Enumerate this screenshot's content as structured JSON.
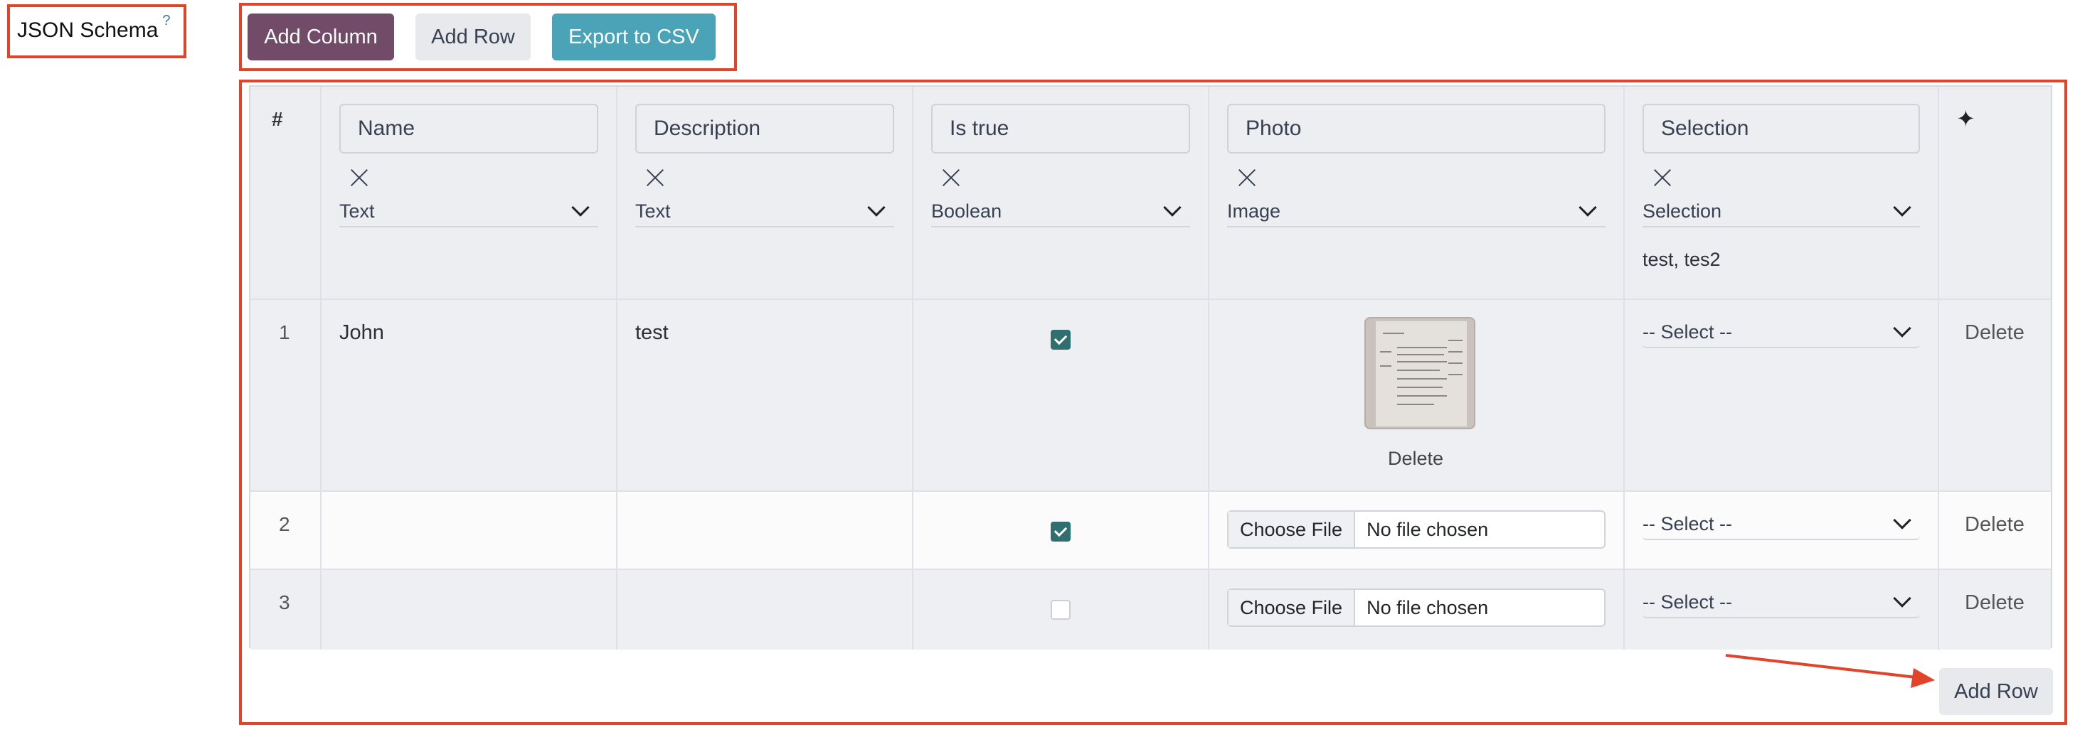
{
  "schema_label": {
    "text": "JSON Schema",
    "help": "?"
  },
  "toolbar": {
    "add_column": "Add Column",
    "add_row": "Add Row",
    "export_csv": "Export to CSV"
  },
  "table": {
    "index_header": "#",
    "actions_header_icon": "sparkle-icon",
    "columns": [
      {
        "name": "Name",
        "type": "Text"
      },
      {
        "name": "Description",
        "type": "Text"
      },
      {
        "name": "Is true",
        "type": "Boolean"
      },
      {
        "name": "Photo",
        "type": "Image"
      },
      {
        "name": "Selection",
        "type": "Selection",
        "options": "test, tes2"
      }
    ],
    "rows": [
      {
        "index": "1",
        "name": "John",
        "description": "test",
        "is_true": true,
        "photo": {
          "has_image": true,
          "delete_label": "Delete"
        },
        "selection": "-- Select --",
        "delete_label": "Delete"
      },
      {
        "index": "2",
        "name": "",
        "description": "",
        "is_true": true,
        "photo": {
          "has_image": false,
          "choose_label": "Choose File",
          "status": "No file chosen"
        },
        "selection": "-- Select --",
        "delete_label": "Delete"
      },
      {
        "index": "3",
        "name": "",
        "description": "",
        "is_true": false,
        "photo": {
          "has_image": false,
          "choose_label": "Choose File",
          "status": "No file chosen"
        },
        "selection": "-- Select --",
        "delete_label": "Delete"
      }
    ]
  },
  "footer": {
    "add_row": "Add Row"
  },
  "colors": {
    "primary": "#714b67",
    "info": "#4ba3b7",
    "annotation": "#e2442a",
    "checkbox": "#2f6f6f"
  }
}
